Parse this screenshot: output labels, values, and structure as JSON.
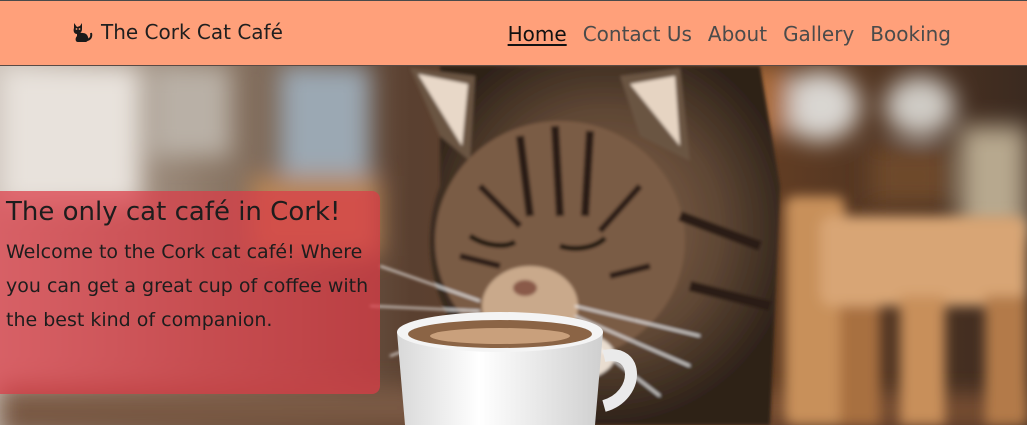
{
  "header": {
    "brand": "The Cork Cat Café",
    "nav": [
      {
        "label": "Home",
        "active": true
      },
      {
        "label": "Contact Us",
        "active": false
      },
      {
        "label": "About",
        "active": false
      },
      {
        "label": "Gallery",
        "active": false
      },
      {
        "label": "Booking",
        "active": false
      }
    ]
  },
  "hero": {
    "title": "The only cat café in Cork!",
    "text": "Welcome to the Cork cat café! Where you can get a great cup of coffee with the best kind of companion.",
    "image": "cat-drinking-coffee"
  },
  "colors": {
    "navbar_bg": "#ffa07a",
    "caption_bg": "#dc3c46"
  }
}
